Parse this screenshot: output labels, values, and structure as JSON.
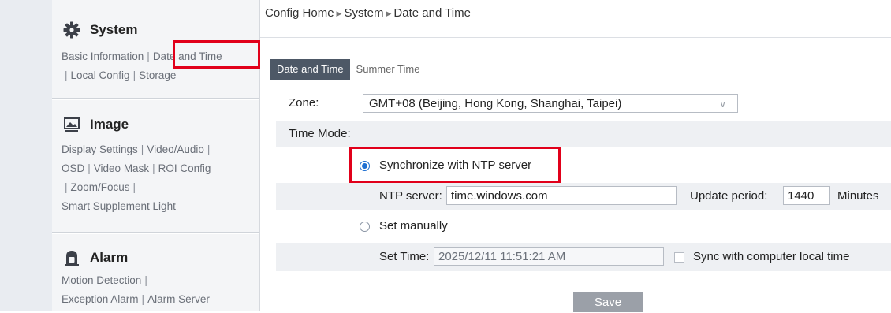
{
  "sidebar": {
    "sections": [
      {
        "title": "System",
        "icon": "gear-icon",
        "links": [
          "Basic Information",
          "Date and Time",
          "Local Config",
          "Storage"
        ]
      },
      {
        "title": "Image",
        "icon": "image-icon",
        "links": [
          "Display Settings",
          "Video/Audio",
          "OSD",
          "Video Mask",
          "ROI Config",
          "Zoom/Focus",
          "Smart Supplement Light"
        ]
      },
      {
        "title": "Alarm",
        "icon": "alarm-light-icon",
        "links": [
          "Motion Detection",
          "Exception Alarm",
          "Alarm Server"
        ]
      }
    ],
    "separator": "|"
  },
  "breadcrumb": {
    "items": [
      "Config Home",
      "System",
      "Date and Time"
    ],
    "arrow": "▶"
  },
  "tabs": [
    {
      "label": "Date and Time",
      "active": true
    },
    {
      "label": "Summer Time",
      "active": false
    }
  ],
  "form": {
    "zone_label": "Zone:",
    "zone_value": "GMT+08 (Beijing, Hong Kong, Shanghai, Taipei)",
    "time_mode_label": "Time Mode:",
    "ntp_option_label": "Synchronize with NTP server",
    "ntp_option_selected": true,
    "ntp_server_label": "NTP server:",
    "ntp_server_value": "time.windows.com",
    "update_period_label": "Update period:",
    "update_period_value": "1440",
    "update_period_unit": "Minutes",
    "manual_option_label": "Set manually",
    "manual_option_selected": false,
    "set_time_label": "Set Time:",
    "set_time_value": "2025/12/11 11:51:21 AM",
    "sync_local_label": "Sync with computer local time",
    "sync_local_checked": false,
    "save_label": "Save"
  },
  "colors": {
    "highlight": "#e1001a",
    "accent": "#1f6fd1",
    "tab_active_bg": "#4d5866",
    "save_bg": "#9ba0a8"
  }
}
